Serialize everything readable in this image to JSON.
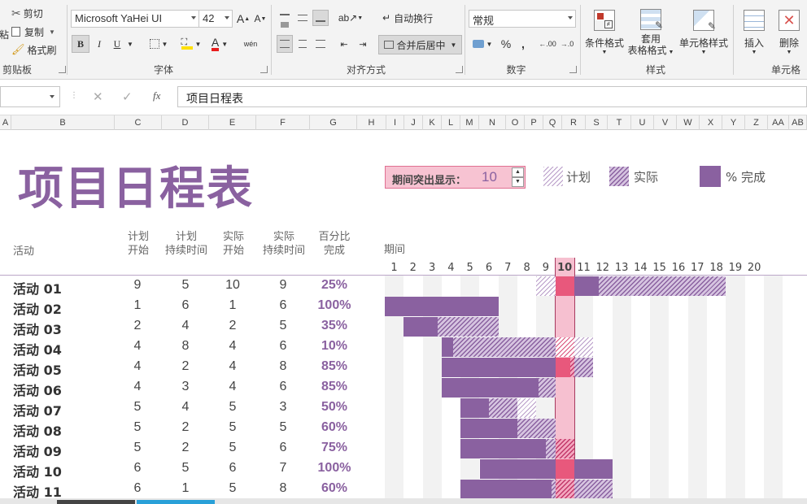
{
  "ribbon": {
    "clipboard": {
      "cut": "剪切",
      "copy": "复制",
      "format_painter": "格式刷",
      "paste_partial": "粘",
      "group": "剪贴板"
    },
    "font": {
      "name": "Microsoft YaHei UI",
      "size": "42",
      "bold": "B",
      "italic": "I",
      "underline": "U",
      "group": "字体",
      "wen": "wén"
    },
    "alignment": {
      "wrap": "自动换行",
      "merge": "合并后居中",
      "group": "对齐方式"
    },
    "number": {
      "format": "常规",
      "percent": "%",
      "comma": ",",
      "inc_dec": ".00",
      "group": "数字"
    },
    "styles": {
      "conditional": "条件格式",
      "table_line1": "套用",
      "table_line2": "表格格式",
      "cell_styles": "单元格样式",
      "group": "样式"
    },
    "cells": {
      "insert": "插入",
      "delete": "删除",
      "group": "单元格"
    }
  },
  "formula_bar": {
    "fx": "fx",
    "content": "项目日程表"
  },
  "columns": [
    "A",
    "B",
    "C",
    "D",
    "E",
    "F",
    "G",
    "H",
    "I",
    "J",
    "K",
    "L",
    "M",
    "N",
    "O",
    "P",
    "Q",
    "R",
    "S",
    "T",
    "U",
    "V",
    "W",
    "X",
    "Y",
    "Z",
    "AA",
    "AB"
  ],
  "sheet": {
    "title": "项目日程表",
    "highlight_label": "期间突出显示：",
    "highlight_value": "10",
    "legend": {
      "plan": "计划",
      "actual": "实际",
      "complete": "% 完成"
    },
    "headers": {
      "activity": "活动",
      "plan_start_1": "计划",
      "plan_start_2": "开始",
      "plan_dur_1": "计划",
      "plan_dur_2": "持续时间",
      "act_start_1": "实际",
      "act_start_2": "开始",
      "act_dur_1": "实际",
      "act_dur_2": "持续时间",
      "pct_1": "百分比",
      "pct_2": "完成",
      "period": "期间"
    },
    "periods": [
      "1",
      "2",
      "3",
      "4",
      "5",
      "6",
      "7",
      "8",
      "9",
      "10",
      "11",
      "12",
      "13",
      "14",
      "15",
      "16",
      "17",
      "18",
      "19",
      "20"
    ],
    "highlight_period": 10,
    "colors": {
      "accent": "#8a61a0",
      "highlight": "#e8587c",
      "highlight_bg": "#f6c0d0"
    },
    "rows": [
      {
        "name": "活动 01",
        "plan_start": "9",
        "plan_dur": "5",
        "act_start": "10",
        "act_dur": "9",
        "pct": "25%",
        "pct_value": 0.25
      },
      {
        "name": "活动 02",
        "plan_start": "1",
        "plan_dur": "6",
        "act_start": "1",
        "act_dur": "6",
        "pct": "100%",
        "pct_value": 1.0
      },
      {
        "name": "活动 03",
        "plan_start": "2",
        "plan_dur": "4",
        "act_start": "2",
        "act_dur": "5",
        "pct": "35%",
        "pct_value": 0.35
      },
      {
        "name": "活动 04",
        "plan_start": "4",
        "plan_dur": "8",
        "act_start": "4",
        "act_dur": "6",
        "pct": "10%",
        "pct_value": 0.1
      },
      {
        "name": "活动 05",
        "plan_start": "4",
        "plan_dur": "2",
        "act_start": "4",
        "act_dur": "8",
        "pct": "85%",
        "pct_value": 0.85
      },
      {
        "name": "活动 06",
        "plan_start": "4",
        "plan_dur": "3",
        "act_start": "4",
        "act_dur": "6",
        "pct": "85%",
        "pct_value": 0.85
      },
      {
        "name": "活动 07",
        "plan_start": "5",
        "plan_dur": "4",
        "act_start": "5",
        "act_dur": "3",
        "pct": "50%",
        "pct_value": 0.5
      },
      {
        "name": "活动 08",
        "plan_start": "5",
        "plan_dur": "2",
        "act_start": "5",
        "act_dur": "5",
        "pct": "60%",
        "pct_value": 0.6
      },
      {
        "name": "活动 09",
        "plan_start": "5",
        "plan_dur": "2",
        "act_start": "5",
        "act_dur": "6",
        "pct": "75%",
        "pct_value": 0.75
      },
      {
        "name": "活动 10",
        "plan_start": "6",
        "plan_dur": "5",
        "act_start": "6",
        "act_dur": "7",
        "pct": "100%",
        "pct_value": 1.0
      },
      {
        "name": "活动 11",
        "plan_start": "6",
        "plan_dur": "1",
        "act_start": "5",
        "act_dur": "8",
        "pct": "60%",
        "pct_value": 0.6
      }
    ]
  }
}
